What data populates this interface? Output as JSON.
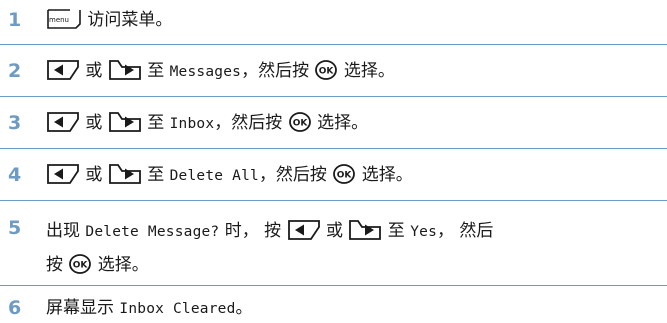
{
  "steps": [
    {
      "number": "1",
      "parts": [
        {
          "icon": "menu-key-icon",
          "label": "menu"
        },
        {
          "text": " 访问菜单。"
        }
      ]
    },
    {
      "number": "2",
      "parts": [
        {
          "icon": "left-nav-key-icon"
        },
        {
          "text": " 或 "
        },
        {
          "icon": "right-nav-key-icon"
        },
        {
          "text": " 至 "
        },
        {
          "mono": "Messages"
        },
        {
          "text": "，然后按 "
        },
        {
          "icon": "ok-key-icon",
          "label": "OK"
        },
        {
          "text": " 选择。"
        }
      ]
    },
    {
      "number": "3",
      "parts": [
        {
          "icon": "left-nav-key-icon"
        },
        {
          "text": " 或 "
        },
        {
          "icon": "right-nav-key-icon"
        },
        {
          "text": " 至 "
        },
        {
          "mono": "Inbox"
        },
        {
          "text": "，然后按 "
        },
        {
          "icon": "ok-key-icon",
          "label": "OK"
        },
        {
          "text": " 选择。"
        }
      ]
    },
    {
      "number": "4",
      "parts": [
        {
          "icon": "left-nav-key-icon"
        },
        {
          "text": " 或 "
        },
        {
          "icon": "right-nav-key-icon"
        },
        {
          "text": " 至 "
        },
        {
          "mono": "Delete All"
        },
        {
          "text": "，然后按 "
        },
        {
          "icon": "ok-key-icon",
          "label": "OK"
        },
        {
          "text": " 选择。"
        }
      ]
    },
    {
      "number": "5",
      "lines": [
        [
          {
            "text": "出现 "
          },
          {
            "mono": "Delete Message?"
          },
          {
            "text": " 时， 按 "
          },
          {
            "icon": "left-nav-key-icon"
          },
          {
            "text": " 或 "
          },
          {
            "icon": "right-nav-key-icon"
          },
          {
            "text": " 至 "
          },
          {
            "mono": "Yes"
          },
          {
            "text": "， 然后"
          }
        ],
        [
          {
            "text": "按 "
          },
          {
            "icon": "ok-key-icon",
            "label": "OK"
          },
          {
            "text": " 选择。"
          }
        ]
      ]
    },
    {
      "number": "6",
      "parts": [
        {
          "text": "屏幕显示 "
        },
        {
          "mono": "Inbox Cleared"
        },
        {
          "text": "。"
        }
      ]
    }
  ],
  "colors": {
    "accent": "#6d9bc3",
    "text": "#1a1a1a"
  }
}
